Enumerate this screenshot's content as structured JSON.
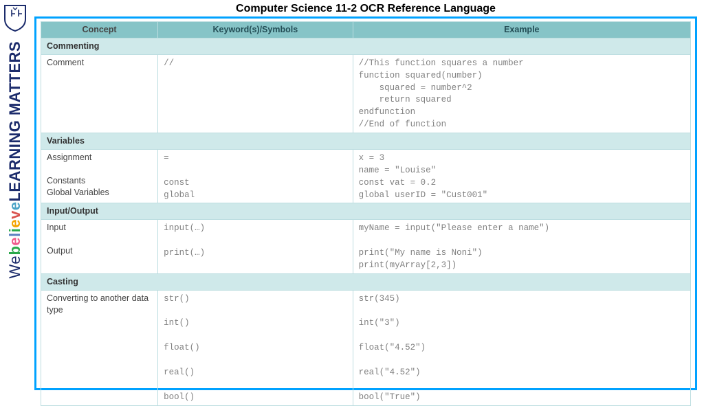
{
  "brand": {
    "tagline_we": "We ",
    "tagline_believe": "believe",
    "tagline_lm": " LEARNING MATTERS"
  },
  "page": {
    "title": "Computer Science 11-2 OCR Reference Language"
  },
  "table": {
    "headers": {
      "concept": "Concept",
      "symbols": "Keyword(s)/Symbols",
      "example": "Example"
    },
    "sections": [
      {
        "name": "Commenting",
        "rows": [
          {
            "concept": "Comment",
            "symbols": "//",
            "example": "//This function squares a number\nfunction squared(number)\n    squared = number^2\n    return squared\nendfunction\n//End of function"
          }
        ]
      },
      {
        "name": "Variables",
        "rows": [
          {
            "concept": "Assignment\n\nConstants\nGlobal Variables",
            "symbols": "=\n\nconst\nglobal",
            "example": "x = 3\nname = \"Louise\"\nconst vat = 0.2\nglobal userID = \"Cust001\""
          }
        ]
      },
      {
        "name": "Input/Output",
        "rows": [
          {
            "concept": "Input\n\nOutput",
            "symbols": "input(…)\n\nprint(…)",
            "example": "myName = input(\"Please enter a name\")\n\nprint(\"My name is Noni\")\nprint(myArray[2,3])"
          }
        ]
      },
      {
        "name": "Casting",
        "rows": [
          {
            "concept": "Converting to another data type",
            "symbols": "str()\n\nint()\n\nfloat()\n\nreal()\n\nbool()",
            "example": "str(345)\n\nint(\"3\")\n\nfloat(\"4.52\")\n\nreal(\"4.52\")\n\nbool(\"True\")"
          }
        ]
      }
    ]
  }
}
